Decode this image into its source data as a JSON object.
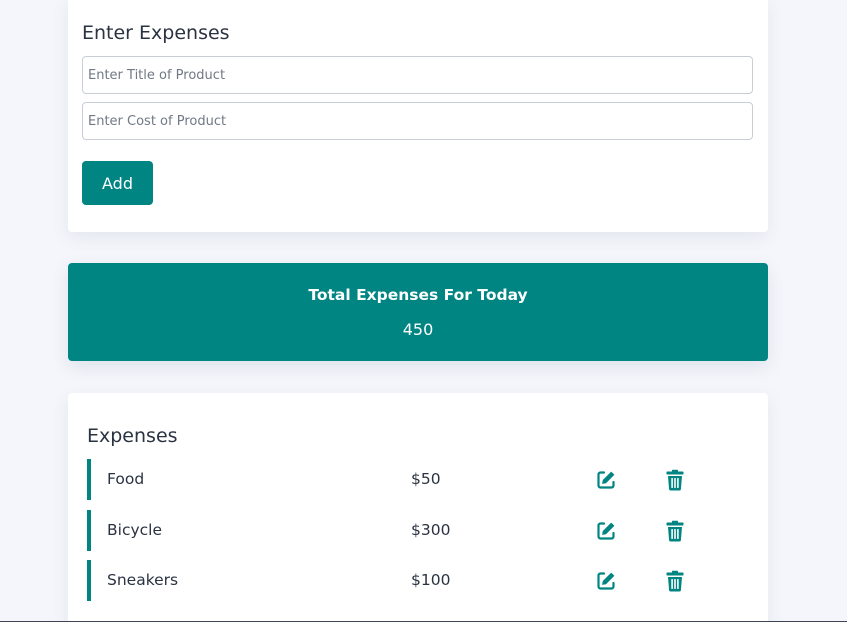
{
  "entry": {
    "title": "Enter Expenses",
    "title_input": {
      "placeholder": "Enter Title of Product",
      "value": ""
    },
    "cost_input": {
      "placeholder": "Enter Cost of Product",
      "value": ""
    },
    "add_label": "Add"
  },
  "total": {
    "label": "Total Expenses For Today",
    "value": "450"
  },
  "expenses": {
    "title": "Expenses",
    "items": [
      {
        "name": "Food",
        "cost": "$50"
      },
      {
        "name": "Bicycle",
        "cost": "$300"
      },
      {
        "name": "Sneakers",
        "cost": "$100"
      }
    ]
  },
  "icons": {
    "edit": "edit-icon",
    "delete": "trash-icon"
  },
  "colors": {
    "accent": "#008582",
    "background": "#f4f6fb",
    "card": "#ffffff",
    "text": "#2a3342"
  }
}
